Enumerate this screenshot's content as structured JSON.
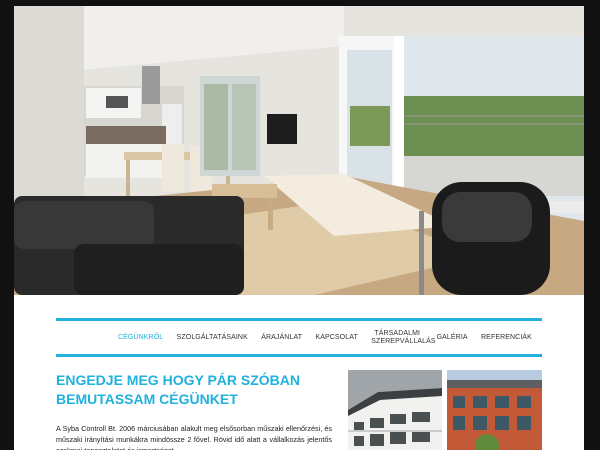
{
  "hero": {
    "image": "apartment-interior-photo"
  },
  "nav": {
    "items": [
      {
        "label": "CÉGÜNKRŐL",
        "active": true
      },
      {
        "label": "SZOLGÁLTATÁSAINK",
        "active": false
      },
      {
        "label": "ÁRAJÁNLAT",
        "active": false
      },
      {
        "label": "KAPCSOLAT",
        "active": false
      },
      {
        "label": "TÁRSADALMI SZEREPVÁLLALÁS",
        "active": false
      },
      {
        "label": "GALÉRIA",
        "active": false
      },
      {
        "label": "REFERENCIÁK",
        "active": false
      }
    ]
  },
  "content": {
    "headline": "ENGEDJE MEG HOGY PÁR SZÓBAN BEMUTASSAM CÉGÜNKET",
    "intro": "A Syba Controll Bt. 2006 márciusában alakult meg elsősorban műszaki ellenőrzési, és műszaki irányítási munkákra mindössze 2 fővel. Rövid idő alatt a vállalkozás jelentős szakmai tapasztalatot és ismertséget"
  },
  "thumbs": [
    {
      "image": "white-building-photo"
    },
    {
      "image": "brick-building-photo"
    }
  ],
  "colors": {
    "accent": "#20b1dc",
    "background": "#111111",
    "page": "#ffffff"
  }
}
